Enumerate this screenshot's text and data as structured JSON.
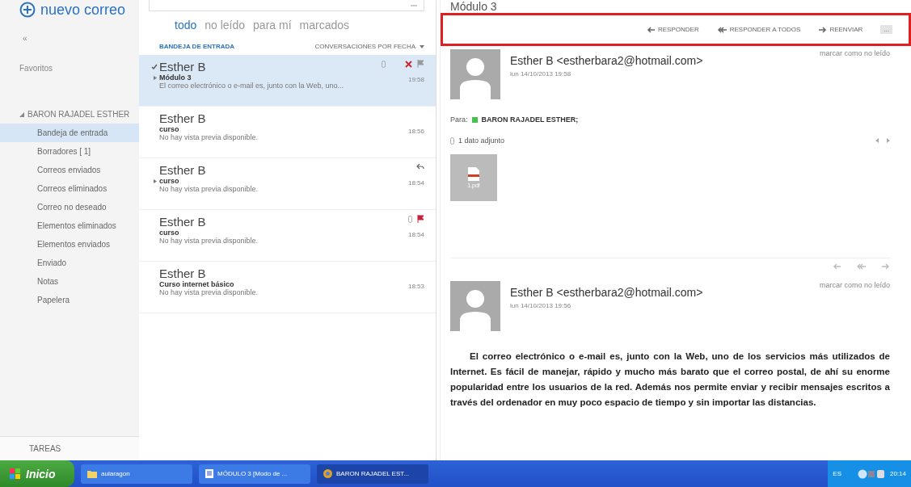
{
  "sidebar": {
    "new_mail": "nuevo correo",
    "collapse": "«",
    "favorites": "Favoritos",
    "account": {
      "name": "BARON RAJADEL ESTHER",
      "expanded": true
    },
    "folders": [
      {
        "label": "Bandeja de entrada",
        "selected": true
      },
      {
        "label": "Borradores [ 1]",
        "selected": false
      },
      {
        "label": "Correos enviados",
        "selected": false
      },
      {
        "label": "Correos eliminados",
        "selected": false
      },
      {
        "label": "Correo no deseado",
        "selected": false
      },
      {
        "label": "Elementos eliminados",
        "selected": false
      },
      {
        "label": "Elementos enviados",
        "selected": false
      },
      {
        "label": "Enviado",
        "selected": false
      },
      {
        "label": "Notas",
        "selected": false
      },
      {
        "label": "Papelera",
        "selected": false
      }
    ],
    "tasks": "TAREAS"
  },
  "mail_list": {
    "filters": [
      {
        "label": "todo",
        "selected": true
      },
      {
        "label": "no leído",
        "selected": false
      },
      {
        "label": "para mí",
        "selected": false
      },
      {
        "label": "marcados",
        "selected": false
      }
    ],
    "folder_title": "BANDEJA DE ENTRADA",
    "sort": "CONVERSACIONES POR FECHA",
    "messages": [
      {
        "sender": "Esther B",
        "subject": "Módulo 3",
        "preview": "El correo electrónico o e-mail es, junto con la Web, uno...",
        "time": "19:58",
        "selected": true,
        "checked": true,
        "expandable": true,
        "attachment": true,
        "flagged": false,
        "replied": false
      },
      {
        "sender": "Esther B",
        "subject": "curso",
        "preview": "No hay vista previa disponible.",
        "time": "18:56",
        "selected": false,
        "checked": false,
        "expandable": false,
        "attachment": false,
        "flagged": false,
        "replied": false
      },
      {
        "sender": "Esther B",
        "subject": "curso",
        "preview": "No hay vista previa disponible.",
        "time": "18:54",
        "selected": false,
        "checked": false,
        "expandable": true,
        "attachment": false,
        "flagged": false,
        "replied": true
      },
      {
        "sender": "Esther B",
        "subject": "curso",
        "preview": "No hay vista previa disponible.",
        "time": "18:54",
        "selected": false,
        "checked": false,
        "expandable": false,
        "attachment": true,
        "flagged": true,
        "replied": false
      },
      {
        "sender": "Esther B",
        "subject": "Curso internet básico",
        "preview": "No hay vista previa disponible.",
        "time": "18:53",
        "selected": false,
        "checked": false,
        "expandable": false,
        "attachment": false,
        "flagged": false,
        "replied": false
      }
    ]
  },
  "reading_pane": {
    "title": "Módulo 3",
    "actions": [
      {
        "kind": "reply",
        "label": "RESPONDER"
      },
      {
        "kind": "reply_all",
        "label": "RESPONDER A TODOS"
      },
      {
        "kind": "forward",
        "label": "REENVIAR"
      },
      {
        "kind": "more",
        "label": "..."
      }
    ],
    "messages": [
      {
        "sender": "Esther B <estherbara2@hotmail.com>",
        "date": "lun 14/10/2013 19:58",
        "mark_unread": "marcar como no leído",
        "to_label": "Para:",
        "to": "BARON RAJADEL ESTHER;",
        "attachments_label": "1 dato adjunto",
        "attachment_name": "1.pdf"
      },
      {
        "sender": "Esther B <estherbara2@hotmail.com>",
        "date": "lun 14/10/2013 19:56",
        "mark_unread": "marcar como no leído",
        "body": "El correo electrónico o e-mail es, junto con la Web, uno de los servicios más utilizados de Internet. Es fácil de manejar, rápido y mucho más barato que el correo postal, de ahí su enorme popularidad entre los usuarios de la red. Además nos permite enviar y recibir mensajes escritos a través del ordenador en muy poco espacio de tiempo y sin importar las distancias."
      }
    ]
  },
  "taskbar": {
    "start": "Inicio",
    "tasks": [
      {
        "label": "aularagon",
        "kind": "folder",
        "selected": false
      },
      {
        "label": "MÓDULO 3 [Modo de ...",
        "kind": "document",
        "selected": false
      },
      {
        "label": "BARON RAJADEL EST...",
        "kind": "browser",
        "selected": true
      }
    ],
    "language": "ES",
    "clock": "20:14"
  }
}
